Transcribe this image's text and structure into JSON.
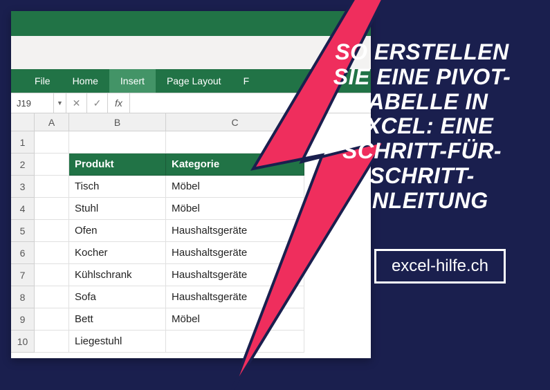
{
  "excel": {
    "tabs": {
      "file": "File",
      "home": "Home",
      "insert": "Insert",
      "pageLayout": "Page Layout",
      "formulas_partial": "F"
    },
    "nameBox": "J19",
    "fx_label": "fx",
    "colHeaders": [
      "A",
      "B",
      "C"
    ],
    "rowHeaders": [
      "1",
      "2",
      "3",
      "4",
      "5",
      "6",
      "7",
      "8",
      "9",
      "10"
    ],
    "tableHeaders": {
      "b": "Produkt",
      "c": "Kategorie"
    },
    "rows": [
      {
        "b": "Tisch",
        "c": "Möbel"
      },
      {
        "b": "Stuhl",
        "c": "Möbel"
      },
      {
        "b": "Ofen",
        "c": "Haushaltsgeräte"
      },
      {
        "b": "Kocher",
        "c": "Haushaltsgeräte"
      },
      {
        "b": "Kühlschrank",
        "c": "Haushaltsgeräte"
      },
      {
        "b": "Sofa",
        "c": "Haushaltsgeräte"
      },
      {
        "b": "Bett",
        "c": "Möbel"
      },
      {
        "b": "Liegestuhl",
        "c": ""
      }
    ]
  },
  "promo": {
    "title": "So erstellen Sie eine Pivot-Tabelle in Excel: Eine Schritt-für-Schritt-Anleitung",
    "badge": "excel-hilfe.ch"
  },
  "colors": {
    "excelGreen": "#217346",
    "bolt": "#ef2e5d",
    "darkNavy": "#1a1f4e"
  }
}
